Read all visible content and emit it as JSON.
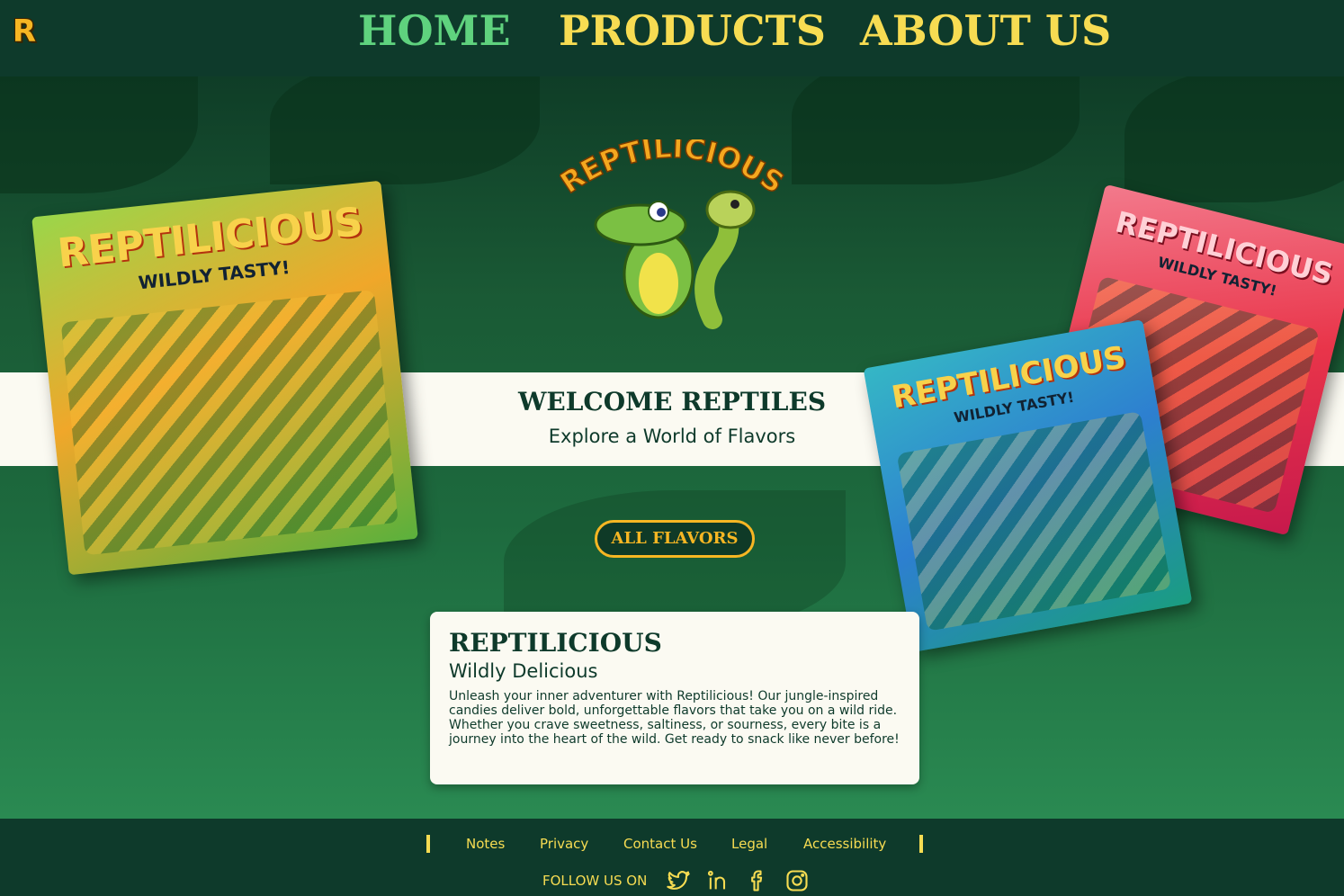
{
  "header": {
    "logo_letter": "R",
    "nav": [
      {
        "label": "HOME"
      },
      {
        "label": "PRODUCTS"
      },
      {
        "label": "ABOUT US"
      }
    ]
  },
  "hero": {
    "brand": "REPTILICIOUS",
    "welcome_title": "WELCOME REPTILES",
    "welcome_subtitle": "Explore a World of Flavors",
    "cta_label": "ALL FLAVORS",
    "bags": [
      {
        "title": "REPTILICIOUS",
        "tagline": "WILDLY TASTY!"
      },
      {
        "title": "REPTILICIOUS",
        "tagline": "WILDLY TASTY!"
      },
      {
        "title": "REPTILICIOUS",
        "tagline": "WILDLY TASTY!"
      }
    ]
  },
  "card": {
    "title": "REPTILICIOUS",
    "subtitle": "Wildly Delicious",
    "body": "Unleash your inner adventurer with Reptilicious! Our jungle-inspired candies deliver bold, unforgettable flavors that take you on a wild ride. Whether you crave sweetness, saltiness, or sourness, every bite is a journey into the heart of the wild. Get ready to snack like never before!"
  },
  "footer": {
    "links": [
      {
        "label": "Notes"
      },
      {
        "label": "Privacy"
      },
      {
        "label": "Contact Us"
      },
      {
        "label": "Legal"
      },
      {
        "label": "Accessibility"
      }
    ],
    "follow_label": "FOLLOW US ON",
    "social": [
      "twitter-icon",
      "linkedin-icon",
      "facebook-icon",
      "instagram-icon"
    ]
  },
  "colors": {
    "dark_green": "#0e3a2b",
    "accent_yellow": "#f7dc52",
    "accent_orange": "#f6b623",
    "nav_active": "#5fd27e",
    "cream": "#fbfaf2"
  }
}
